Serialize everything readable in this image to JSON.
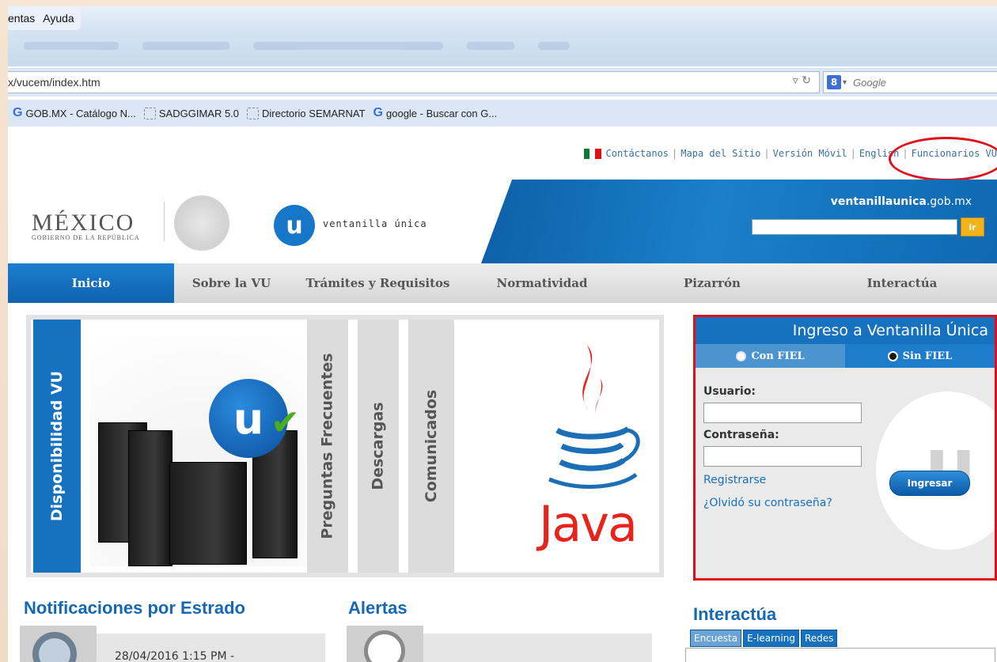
{
  "browser": {
    "menu": [
      "entas",
      "Ayuda"
    ],
    "url": "x/vucem/index.htm",
    "search_placeholder": "Google",
    "search_engine_badge": "8",
    "bookmarks": [
      {
        "label": "GOB.MX - Catálogo N...",
        "icon": "google-icon"
      },
      {
        "label": "SADGGIMAR 5.0",
        "icon": "page-icon"
      },
      {
        "label": "Directorio SEMARNAT",
        "icon": "page-icon"
      },
      {
        "label": "google - Buscar con G...",
        "icon": "google-icon"
      }
    ]
  },
  "toplinks": [
    "Contáctanos",
    "Mapa del Sitio",
    "Versión Móvil",
    "English",
    "Funcionarios VU"
  ],
  "header": {
    "mexico": "MÉXICO",
    "mexico_sub": "GOBIERNO DE LA REPÚBLICA",
    "logo_letter": "u",
    "vu_name": "ventanilla única",
    "domain_bold": "ventanillaunica",
    "domain_rest": ".gob.mx",
    "search_button": "ir"
  },
  "nav": [
    "Inicio",
    "Sobre la VU",
    "Trámites y Requisitos",
    "Normatividad",
    "Pizarrón",
    "Interactúa"
  ],
  "feature": {
    "tabs": [
      "Disponibilidad VU",
      "Preguntas Frecuentes",
      "Descargas",
      "Comunicados"
    ],
    "java": "Java"
  },
  "login": {
    "title": "Ingreso a Ventanilla Única",
    "tab_con": "Con FIEL",
    "tab_sin": "Sin FIEL",
    "usuario": "Usuario:",
    "contrasena": "Contraseña:",
    "registrarse": "Registrarse",
    "olvido": "¿Olvidó su contraseña?",
    "ingresar": "Ingresar"
  },
  "sections": {
    "notificaciones": "Notificaciones por Estrado",
    "notif_date": "28/04/2016 1:15 PM -",
    "alertas": "Alertas",
    "interactua": "Interactúa",
    "int_tabs": [
      "Encuesta",
      "E-learning",
      "Redes"
    ]
  },
  "colors": {
    "accent": "#1672bf",
    "highlight": "#e0101a"
  }
}
